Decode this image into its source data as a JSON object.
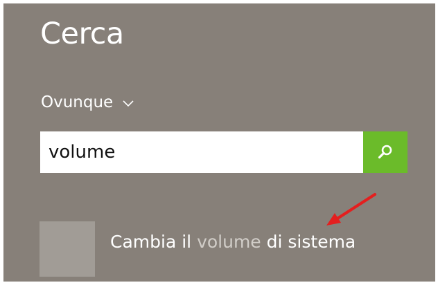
{
  "search_pane": {
    "title": "Cerca",
    "scope": {
      "label": "Ovunque",
      "icon": "chevron-down-icon"
    },
    "search": {
      "value": "volume",
      "button_icon": "search-icon"
    },
    "result": {
      "before": "Cambia il ",
      "match": "volume",
      "after": " di sistema"
    }
  },
  "colors": {
    "panel_background": "#878079",
    "search_button": "#6bbb2a",
    "highlight_text": "#d1cdc8",
    "annotation_arrow": "#e41f1f"
  }
}
